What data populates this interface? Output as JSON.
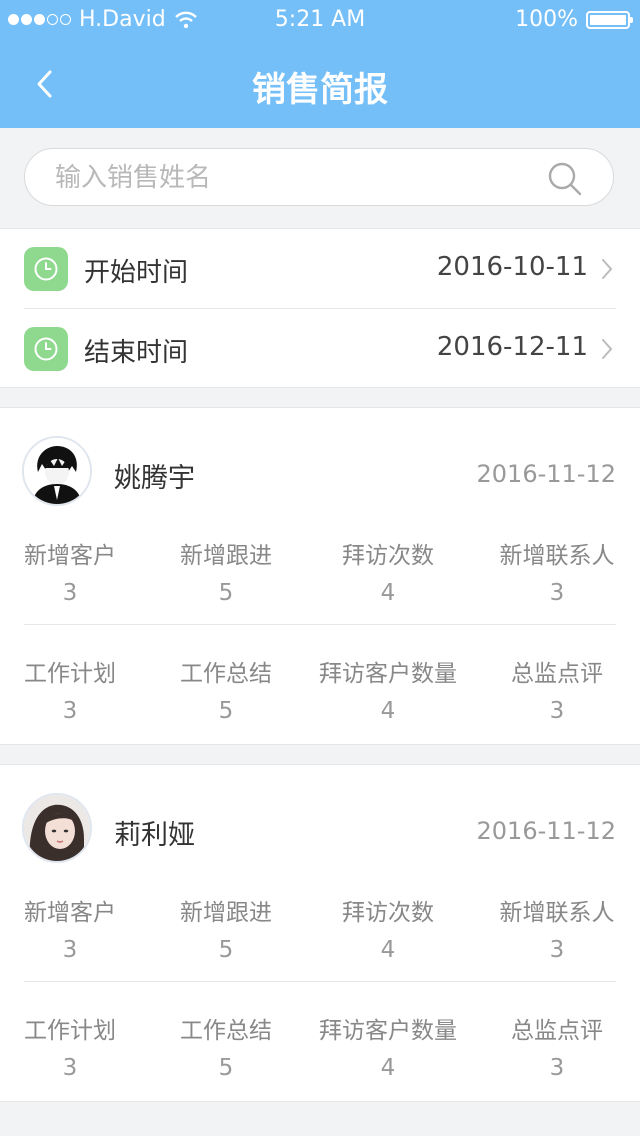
{
  "status_bar": {
    "carrier": "H.David",
    "time": "5:21 AM",
    "battery": "100%"
  },
  "nav": {
    "title": "销售简报"
  },
  "search": {
    "placeholder": "输入销售姓名",
    "value": ""
  },
  "date_filter": {
    "start_label": "开始时间",
    "start_value": "2016-10-11",
    "end_label": "结束时间",
    "end_value": "2016-12-11"
  },
  "reports": [
    {
      "name": "姚腾宇",
      "date": "2016-11-12",
      "stats_row1": [
        {
          "label": "新增客户",
          "value": "3"
        },
        {
          "label": "新增跟进",
          "value": "5"
        },
        {
          "label": "拜访次数",
          "value": "4"
        },
        {
          "label": "新增联系人",
          "value": "3"
        }
      ],
      "stats_row2": [
        {
          "label": "工作计划",
          "value": "3"
        },
        {
          "label": "工作总结",
          "value": "5"
        },
        {
          "label": "拜访客户数量",
          "value": "4"
        },
        {
          "label": "总监点评",
          "value": "3"
        }
      ]
    },
    {
      "name": "莉利娅",
      "date": "2016-11-12",
      "stats_row1": [
        {
          "label": "新增客户",
          "value": "3"
        },
        {
          "label": "新增跟进",
          "value": "5"
        },
        {
          "label": "拜访次数",
          "value": "4"
        },
        {
          "label": "新增联系人",
          "value": "3"
        }
      ],
      "stats_row2": [
        {
          "label": "工作计划",
          "value": "3"
        },
        {
          "label": "工作总结",
          "value": "5"
        },
        {
          "label": "拜访客户数量",
          "value": "4"
        },
        {
          "label": "总监点评",
          "value": "3"
        }
      ]
    }
  ],
  "colors": {
    "header": "#75bff8",
    "clock_badge": "#8fd98e",
    "background": "#f2f3f5"
  }
}
